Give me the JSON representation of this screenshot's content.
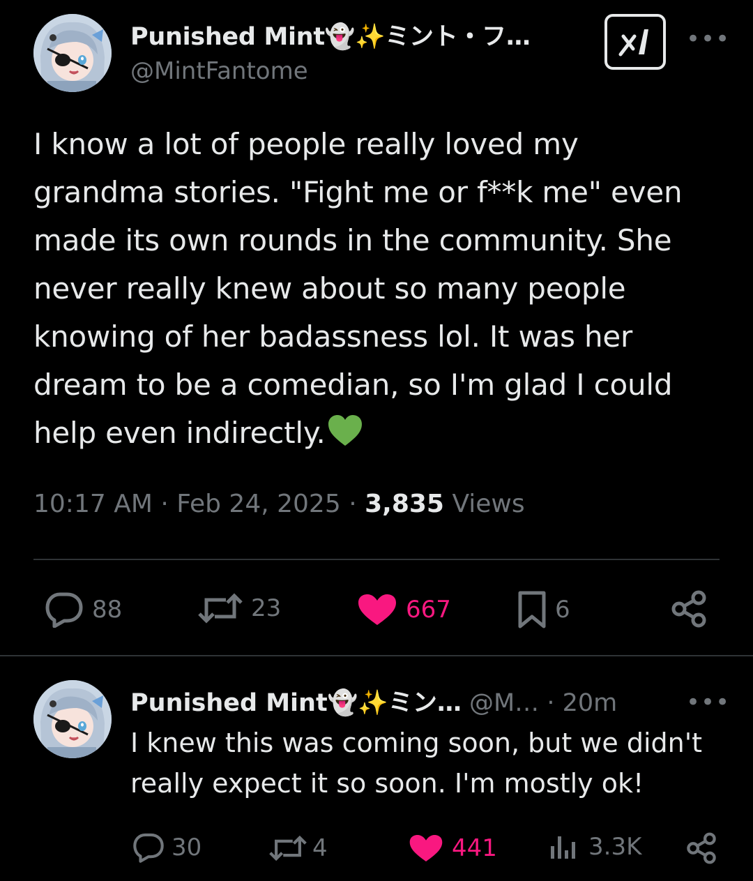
{
  "tweet": {
    "author": {
      "display_name": "Punished Mint👻✨ミント・フ…",
      "handle": "@MintFantome",
      "avatar_icon": "anime-avatar-icon"
    },
    "text_lines": [
      "I know a lot of people really loved my",
      "grandma stories. \"Fight me or f**k me\" even",
      "made its own rounds in the community. She",
      "never really knew about so many people",
      "knowing of her badassness lol. It was her",
      "dream to be a comedian, so I'm glad I could",
      "help even indirectly."
    ],
    "time": "10:17 AM",
    "date": "Feb 24, 2025",
    "views_count": "3,835",
    "views_label": "Views",
    "separator": "·",
    "actions": {
      "replies": "88",
      "reposts": "23",
      "likes": "667",
      "bookmarks": "6"
    }
  },
  "reply": {
    "display_name": "Punished Mint👻✨ミン…",
    "handle": "@M…",
    "time": "20m",
    "text_lines": [
      "I knew this was coming soon, but we didn't",
      "really expect it so soon. I'm mostly ok!"
    ],
    "actions": {
      "replies": "30",
      "reposts": "4",
      "likes": "441",
      "views": "3.3K"
    }
  },
  "colors": {
    "background": "#000000",
    "text": "#e7e9ea",
    "secondary": "#71767b",
    "like": "#f91880",
    "divider": "#2f3336",
    "green_heart": "#6ab04c"
  }
}
